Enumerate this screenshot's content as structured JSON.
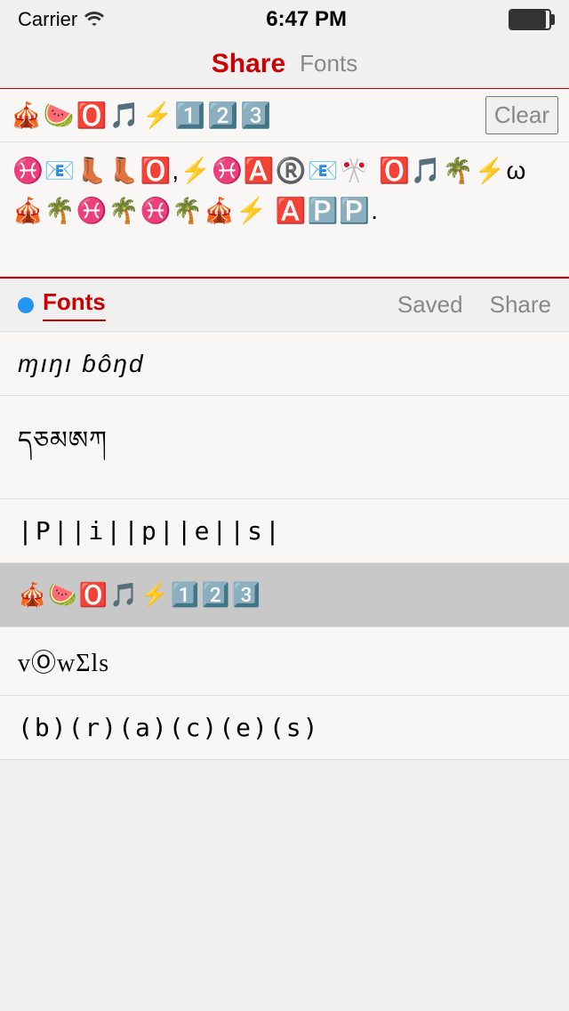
{
  "statusBar": {
    "carrier": "Carrier",
    "wifi": "wifi",
    "time": "6:47 PM",
    "battery": "full"
  },
  "navBar": {
    "activeTitle": "Share",
    "inactiveTitle": "Fonts"
  },
  "inputArea": {
    "emojiRow": "🎪🍉🅾️🎵⚡1️⃣2️⃣3️⃣",
    "clearLabel": "Clear",
    "composedText": "♓️📧👢👢🅾️,⚡♓️🅰️®️📧🎌\n🅾️🎵🌴⚡ω🎪🌴♓️🌴♓️🌴🎪⚡\n🅰️🅿️🅿️."
  },
  "bottomTabs": {
    "fontsLabel": "Fonts",
    "savedLabel": "Saved",
    "shareLabel": "Share"
  },
  "fontList": [
    {
      "id": "font-1",
      "text": "ɱıŋı ɓôŋd",
      "style": "style1",
      "selected": false
    },
    {
      "id": "font-2",
      "text": "དཅམཨཀ",
      "style": "style2",
      "selected": false
    },
    {
      "id": "font-3",
      "text": "|P||i||p||e||s|",
      "style": "style3",
      "selected": false
    },
    {
      "id": "font-4",
      "text": "🎪🍉🅾️🎵⚡1️⃣2️⃣3️⃣",
      "style": "style4",
      "selected": true
    },
    {
      "id": "font-5",
      "text": "vⓄwΣls",
      "style": "style5",
      "selected": false
    },
    {
      "id": "font-6",
      "text": "(b)(r)(a)(c)(e)(s)",
      "style": "style6",
      "selected": false
    }
  ]
}
